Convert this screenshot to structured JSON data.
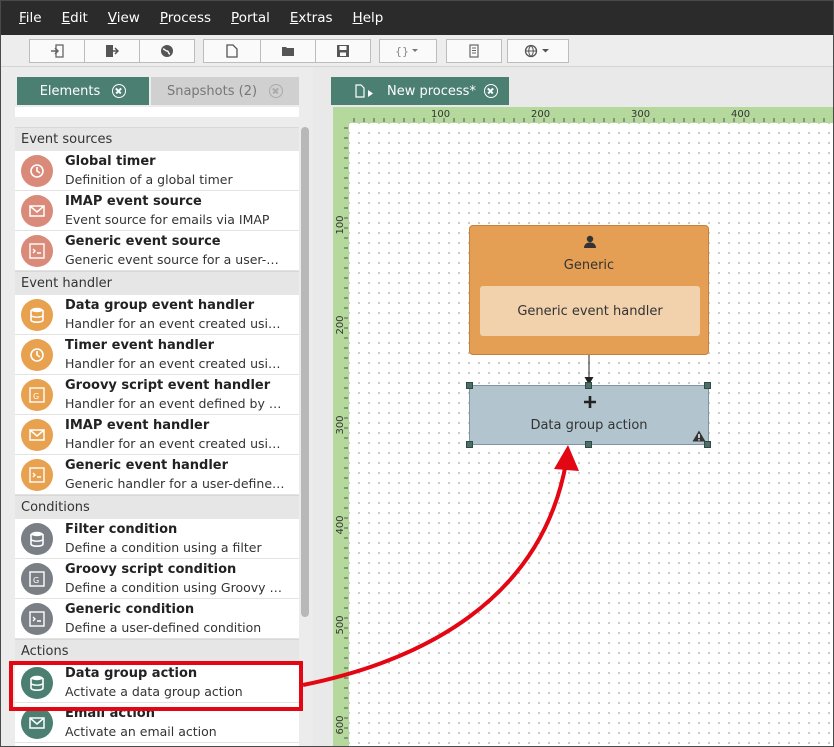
{
  "menubar": {
    "items": [
      {
        "label": "File",
        "accel": "F",
        "rest": "ile"
      },
      {
        "label": "Edit",
        "accel": "E",
        "rest": "dit"
      },
      {
        "label": "View",
        "accel": "V",
        "rest": "iew"
      },
      {
        "label": "Process",
        "accel": "P",
        "rest": "rocess"
      },
      {
        "label": "Portal",
        "accel": "P",
        "rest": "ortal"
      },
      {
        "label": "Extras",
        "accel": "E",
        "rest": "xtras"
      },
      {
        "label": "Help",
        "accel": "H",
        "rest": "elp"
      }
    ]
  },
  "toolbar": {
    "buttons": [
      "import-icon",
      "export-icon",
      "globe-icon",
      "new-file-icon",
      "open-folder-icon",
      "save-icon",
      "braces-dropdown-icon",
      "document-icon",
      "web-dropdown-icon"
    ]
  },
  "left_panel": {
    "tabs": {
      "elements": "Elements",
      "snapshots": "Snapshots (2)"
    },
    "groups": [
      {
        "header": "Event sources",
        "items": [
          {
            "title": "Global timer",
            "desc": "Definition of a global timer",
            "icon": "clock-add-icon",
            "color": "#d98a78"
          },
          {
            "title": "IMAP event source",
            "desc": "Event source for emails via IMAP",
            "icon": "envelope-add-icon",
            "color": "#d98a78"
          },
          {
            "title": "Generic event source",
            "desc": "Generic event source for a user-defi...",
            "icon": "script-add-icon",
            "color": "#d98a78"
          }
        ]
      },
      {
        "header": "Event handler",
        "items": [
          {
            "title": "Data group event handler",
            "desc": "Handler for an event created using ...",
            "icon": "database-bolt-icon",
            "color": "#e8a14e"
          },
          {
            "title": "Timer event handler",
            "desc": "Handler for an event created using ...",
            "icon": "clock-bolt-icon",
            "color": "#e8a14e"
          },
          {
            "title": "Groovy script event handler",
            "desc": "Handler for an event defined by a G...",
            "icon": "groovy-bolt-icon",
            "color": "#e8a14e"
          },
          {
            "title": "IMAP event handler",
            "desc": "Handler for an event created using ...",
            "icon": "envelope-bolt-icon",
            "color": "#e8a14e"
          },
          {
            "title": "Generic event handler",
            "desc": "Generic handler for a user-defined e...",
            "icon": "script-bolt-icon",
            "color": "#e8a14e"
          }
        ]
      },
      {
        "header": "Conditions",
        "items": [
          {
            "title": "Filter condition",
            "desc": "Define a condition using a filter",
            "icon": "database-filter-icon",
            "color": "#7a7f86"
          },
          {
            "title": "Groovy script condition",
            "desc": "Define a condition using Groovy scri...",
            "icon": "groovy-condition-icon",
            "color": "#7a7f86"
          },
          {
            "title": "Generic condition",
            "desc": "Define a user-defined condition",
            "icon": "script-condition-icon",
            "color": "#7a7f86"
          }
        ]
      },
      {
        "header": "Actions",
        "items": [
          {
            "title": "Data group action",
            "desc": "Activate a data group action",
            "icon": "database-gear-icon",
            "color": "#4a7f72"
          },
          {
            "title": "Email action",
            "desc": "Activate an email action",
            "icon": "envelope-gear-icon",
            "color": "#4a7f72"
          }
        ]
      }
    ]
  },
  "editor": {
    "tab_label": "New process*",
    "ruler_top": [
      "100",
      "200",
      "300",
      "400"
    ],
    "ruler_left": [
      "100",
      "200",
      "300",
      "400",
      "500",
      "600"
    ],
    "event_node": {
      "title": "Generic",
      "inner_label": "Generic event handler",
      "icon": "person-icon"
    },
    "action_node": {
      "label": "Data group action",
      "icon": "plus-icon",
      "warning_icon": "warning-icon"
    }
  },
  "colors": {
    "accent": "#4a7f72",
    "event_node": "#e59f55",
    "event_inner": "#f2d1ad",
    "action_node": "#b2c5cf",
    "highlight": "#e30613",
    "ruler": "#b5d99c"
  }
}
